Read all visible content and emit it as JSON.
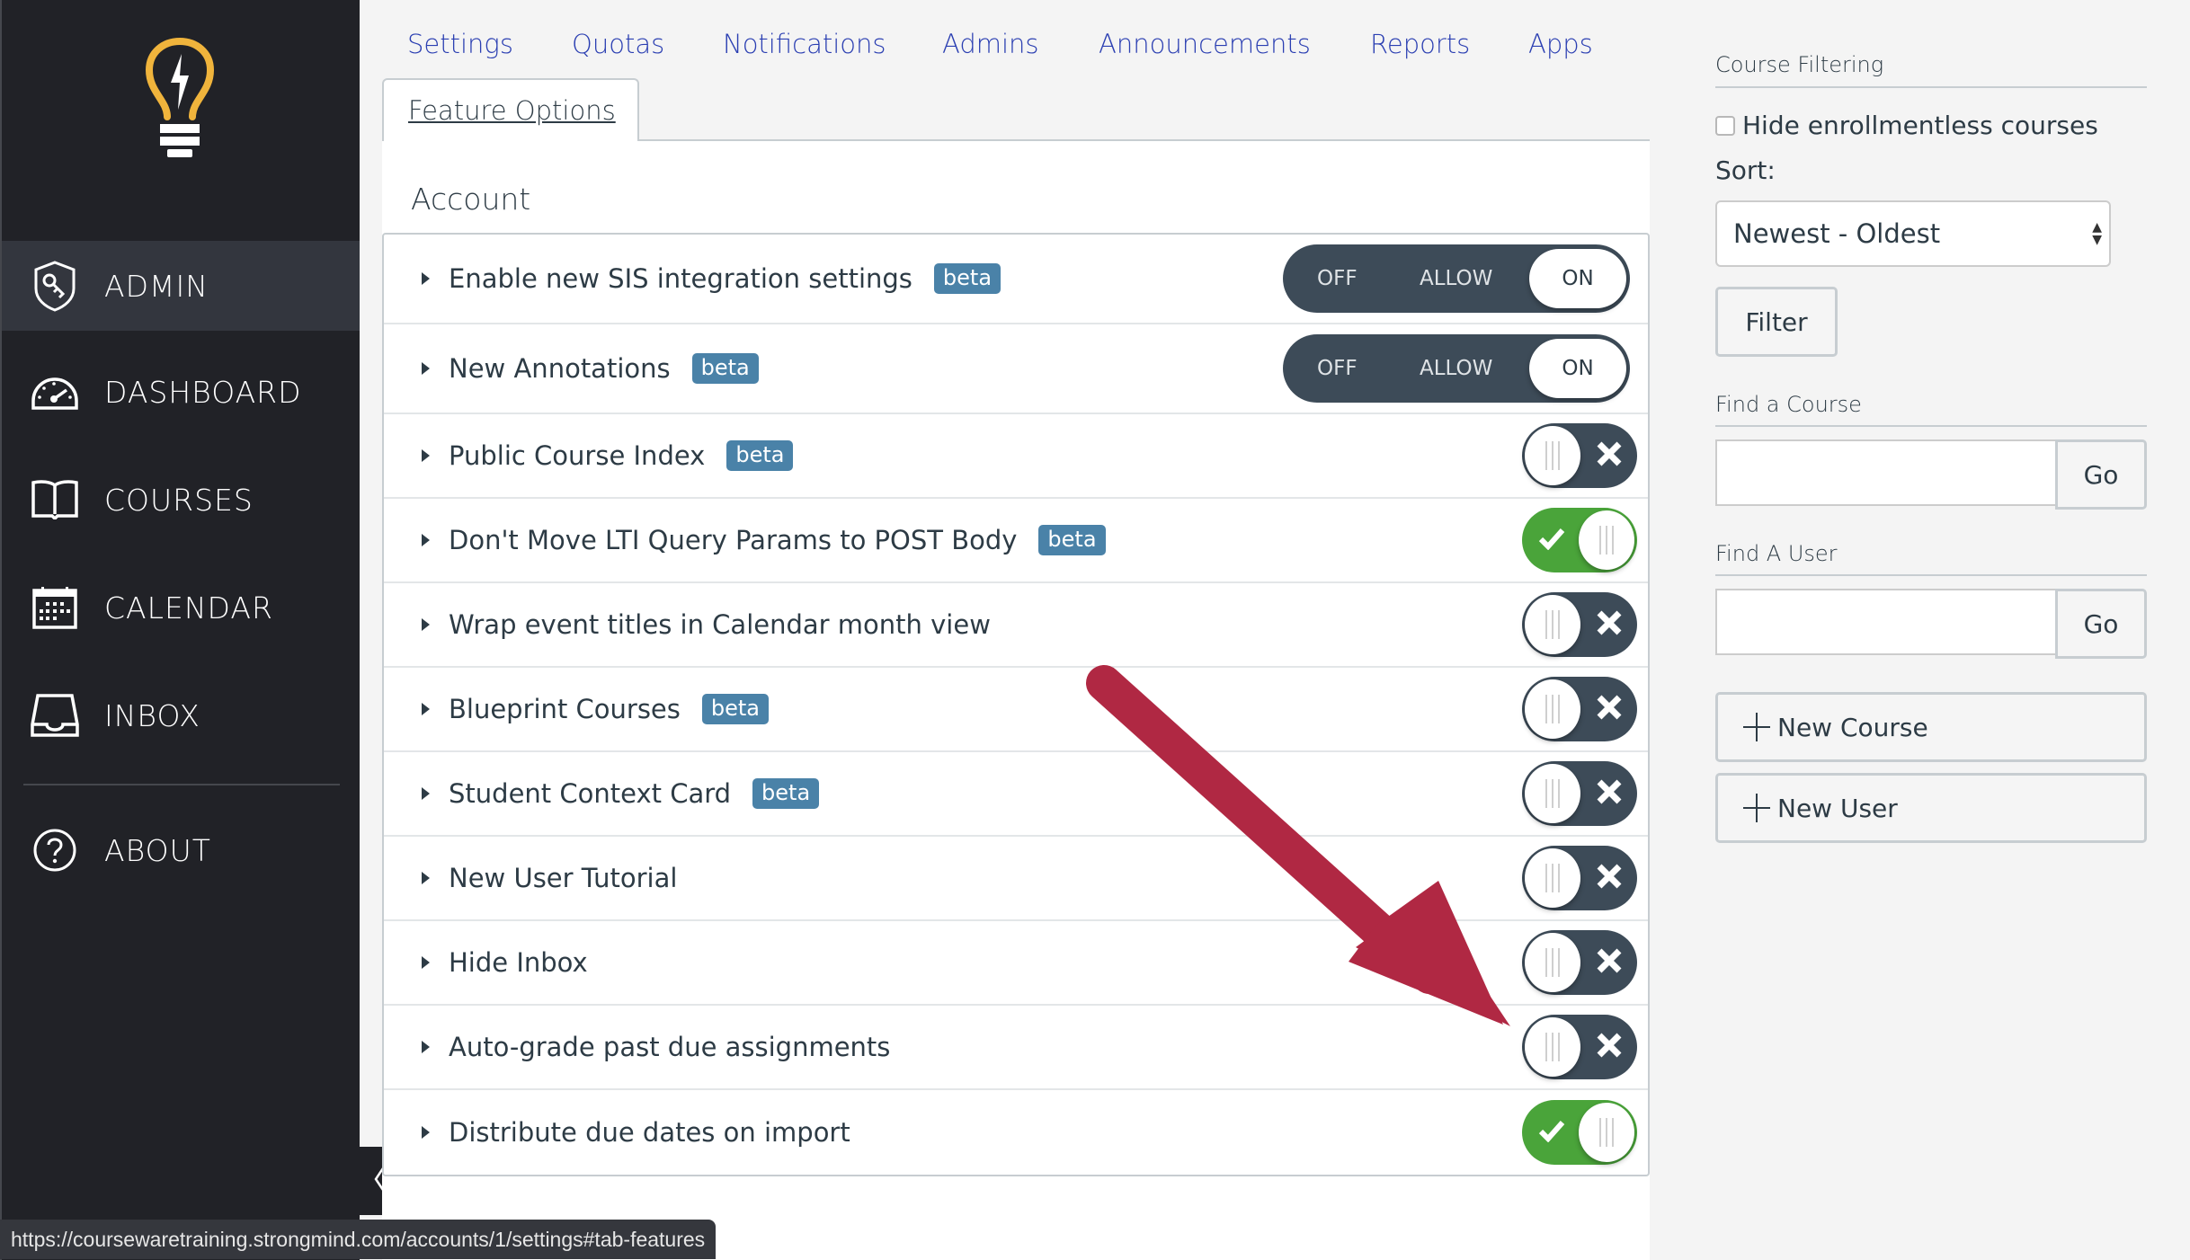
{
  "sidebar": {
    "logo": "lightbulb-logo",
    "items": [
      {
        "label": "ADMIN",
        "icon": "shield-key-icon",
        "active": true
      },
      {
        "label": "DASHBOARD",
        "icon": "speedometer-icon",
        "active": false
      },
      {
        "label": "COURSES",
        "icon": "open-book-icon",
        "active": false
      },
      {
        "label": "CALENDAR",
        "icon": "calendar-icon",
        "active": false
      },
      {
        "label": "INBOX",
        "icon": "inbox-tray-icon",
        "active": false
      },
      {
        "label": "ABOUT",
        "icon": "question-circle-icon",
        "active": false
      }
    ],
    "collapse_icon": "chevron-left-icon"
  },
  "tabs": {
    "links": [
      "Settings",
      "Quotas",
      "Notifications",
      "Admins",
      "Announcements",
      "Reports",
      "Apps"
    ],
    "active": "Feature Options"
  },
  "section": {
    "title": "Account",
    "features": [
      {
        "label": "Enable new SIS integration settings",
        "beta": "beta",
        "control": "tri-state",
        "state": "ON",
        "options": [
          "OFF",
          "ALLOW",
          "ON"
        ]
      },
      {
        "label": "New Annotations",
        "beta": "beta",
        "control": "tri-state",
        "state": "ON",
        "options": [
          "OFF",
          "ALLOW",
          "ON"
        ]
      },
      {
        "label": "Public Course Index",
        "beta": "beta",
        "control": "toggle",
        "state": "off"
      },
      {
        "label": "Don't Move LTI Query Params to POST Body",
        "beta": "beta",
        "control": "toggle",
        "state": "on"
      },
      {
        "label": "Wrap event titles in Calendar month view",
        "beta": null,
        "control": "toggle",
        "state": "off"
      },
      {
        "label": "Blueprint Courses",
        "beta": "beta",
        "control": "toggle",
        "state": "off"
      },
      {
        "label": "Student Context Card",
        "beta": "beta",
        "control": "toggle",
        "state": "off"
      },
      {
        "label": "New User Tutorial",
        "beta": null,
        "control": "toggle",
        "state": "off"
      },
      {
        "label": "Hide Inbox",
        "beta": null,
        "control": "toggle",
        "state": "off"
      },
      {
        "label": "Auto-grade past due assignments",
        "beta": null,
        "control": "toggle",
        "state": "off"
      },
      {
        "label": "Distribute due dates on import",
        "beta": null,
        "control": "toggle",
        "state": "on"
      }
    ]
  },
  "annotation": {
    "type": "arrow",
    "color": "#b02843",
    "points_to": "Auto-grade past due assignments"
  },
  "right_panel": {
    "course_filtering": "Course Filtering",
    "hide_enrollmentless": "Hide enrollmentless courses",
    "hide_enrollmentless_checked": false,
    "sort_label": "Sort:",
    "sort_value": "Newest - Oldest",
    "filter_button": "Filter",
    "find_course": "Find a Course",
    "find_course_value": "",
    "find_user": "Find A User",
    "find_user_value": "",
    "go_label": "Go",
    "new_course": "New Course",
    "new_user": "New User"
  },
  "status_bar": {
    "url": "https://coursewaretraining.strongmind.com/accounts/1/settings#tab-features"
  },
  "colors": {
    "sidebar_bg": "#212227",
    "sidebar_active": "#33363e",
    "logo_yellow": "#f0b43c",
    "link_blue": "#2b3fb2",
    "beta_badge": "#4a82a8",
    "toggle_dark": "#3d4b58",
    "toggle_green": "#4aa43a",
    "arrow_red": "#b02843"
  }
}
